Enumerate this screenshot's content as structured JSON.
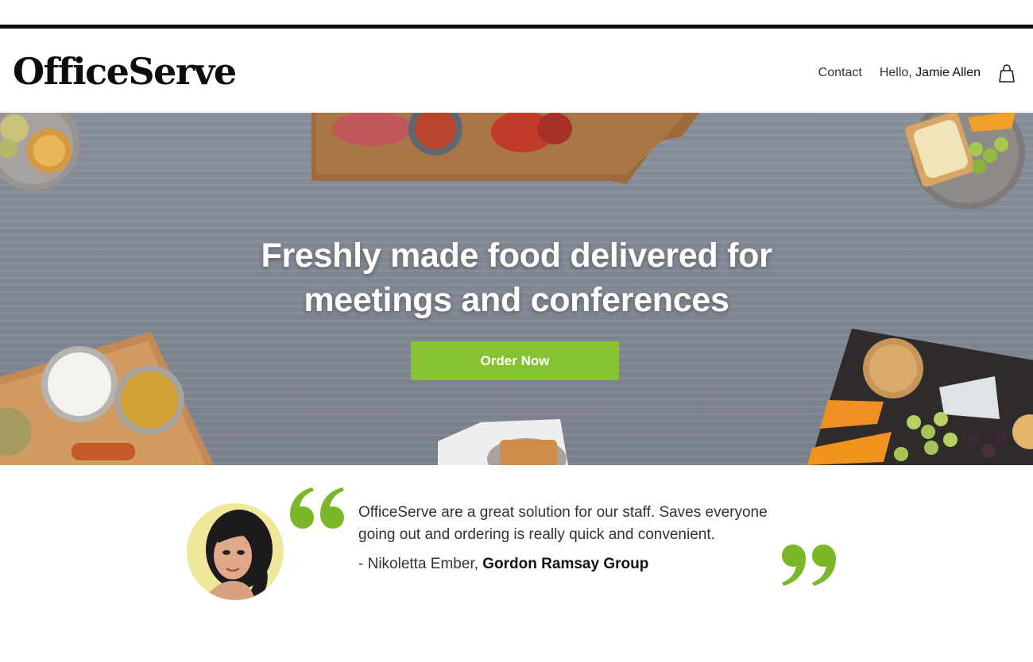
{
  "brand": {
    "name": "OfficeServe"
  },
  "nav": {
    "contact_label": "Contact",
    "greeting": "Hello,",
    "user_name": "Jamie Allen"
  },
  "hero": {
    "title_line1": "Freshly made food delivered for",
    "title_line2": "meetings and conferences",
    "cta_label": "Order Now"
  },
  "testimonial": {
    "quote": "OfficeServe are a great solution for our staff. Saves everyone going out and ordering is really quick and convenient.",
    "author_prefix": "- Nikoletta Ember,",
    "author_company": "Gordon Ramsay Group"
  },
  "colors": {
    "accent": "#86c232",
    "header_rule": "#0d0d0d",
    "hero_background": "#848a95"
  },
  "icons": {
    "cart": "shopping-bag-icon",
    "quote_open": "open-quote-icon",
    "quote_close": "close-quote-icon"
  }
}
